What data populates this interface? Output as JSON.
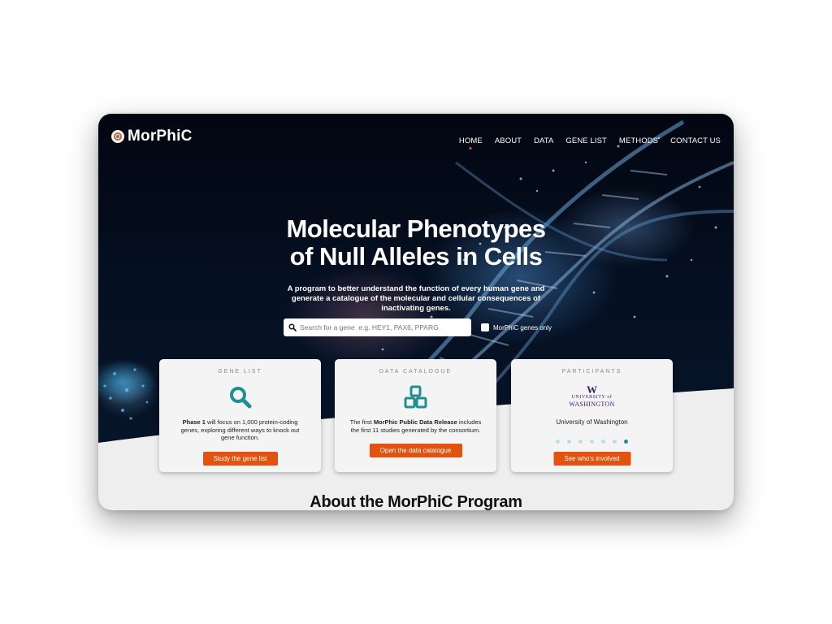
{
  "brand": {
    "name": "MorPhiC"
  },
  "nav": {
    "items": [
      "HOME",
      "ABOUT",
      "DATA",
      "GENE LIST",
      "METHODS",
      "CONTACT US"
    ],
    "active": "HOME"
  },
  "hero": {
    "title_line1": "Molecular Phenotypes",
    "title_line2": "of Null Alleles in Cells",
    "subtitle": "A program to better understand the function of every human gene and generate a catalogue of the molecular and cellular consequences of inactivating genes."
  },
  "search": {
    "placeholder": "Search for a gene  e.g. HEY1, PAX6, PPARG",
    "value": "",
    "only_label": "MorPhiC genes only",
    "only_checked": false
  },
  "cards": {
    "gene_list": {
      "header": "GENE LIST",
      "icon": "magnifier-icon",
      "text_bold": "Phase 1",
      "text_rest": " will focus on 1,000 protein-coding genes, exploring different ways to knock out gene function.",
      "button": "Study the gene list"
    },
    "data_catalogue": {
      "header": "DATA CATALOGUE",
      "icon": "cubes-icon",
      "text_pre": "The first ",
      "text_bold": "MorPhic Public Data Release",
      "text_post": " includes the first 11 studies generated by the consortium.",
      "button": "Open the data catalogue"
    },
    "participants": {
      "header": "PARTICIPANTS",
      "logo_mark": "W",
      "logo_line1": "UNIVERSITY of",
      "logo_line2": "WASHINGTON",
      "name": "University of Washington",
      "slide_count": 7,
      "active_slide": 7,
      "button": "See who's involved"
    }
  },
  "about": {
    "heading": "About the MorPhiC Program"
  },
  "colors": {
    "accent": "#e3530f",
    "teal": "#1f8f93",
    "uw_purple": "#3a2074",
    "hero_bg": "#051022"
  }
}
